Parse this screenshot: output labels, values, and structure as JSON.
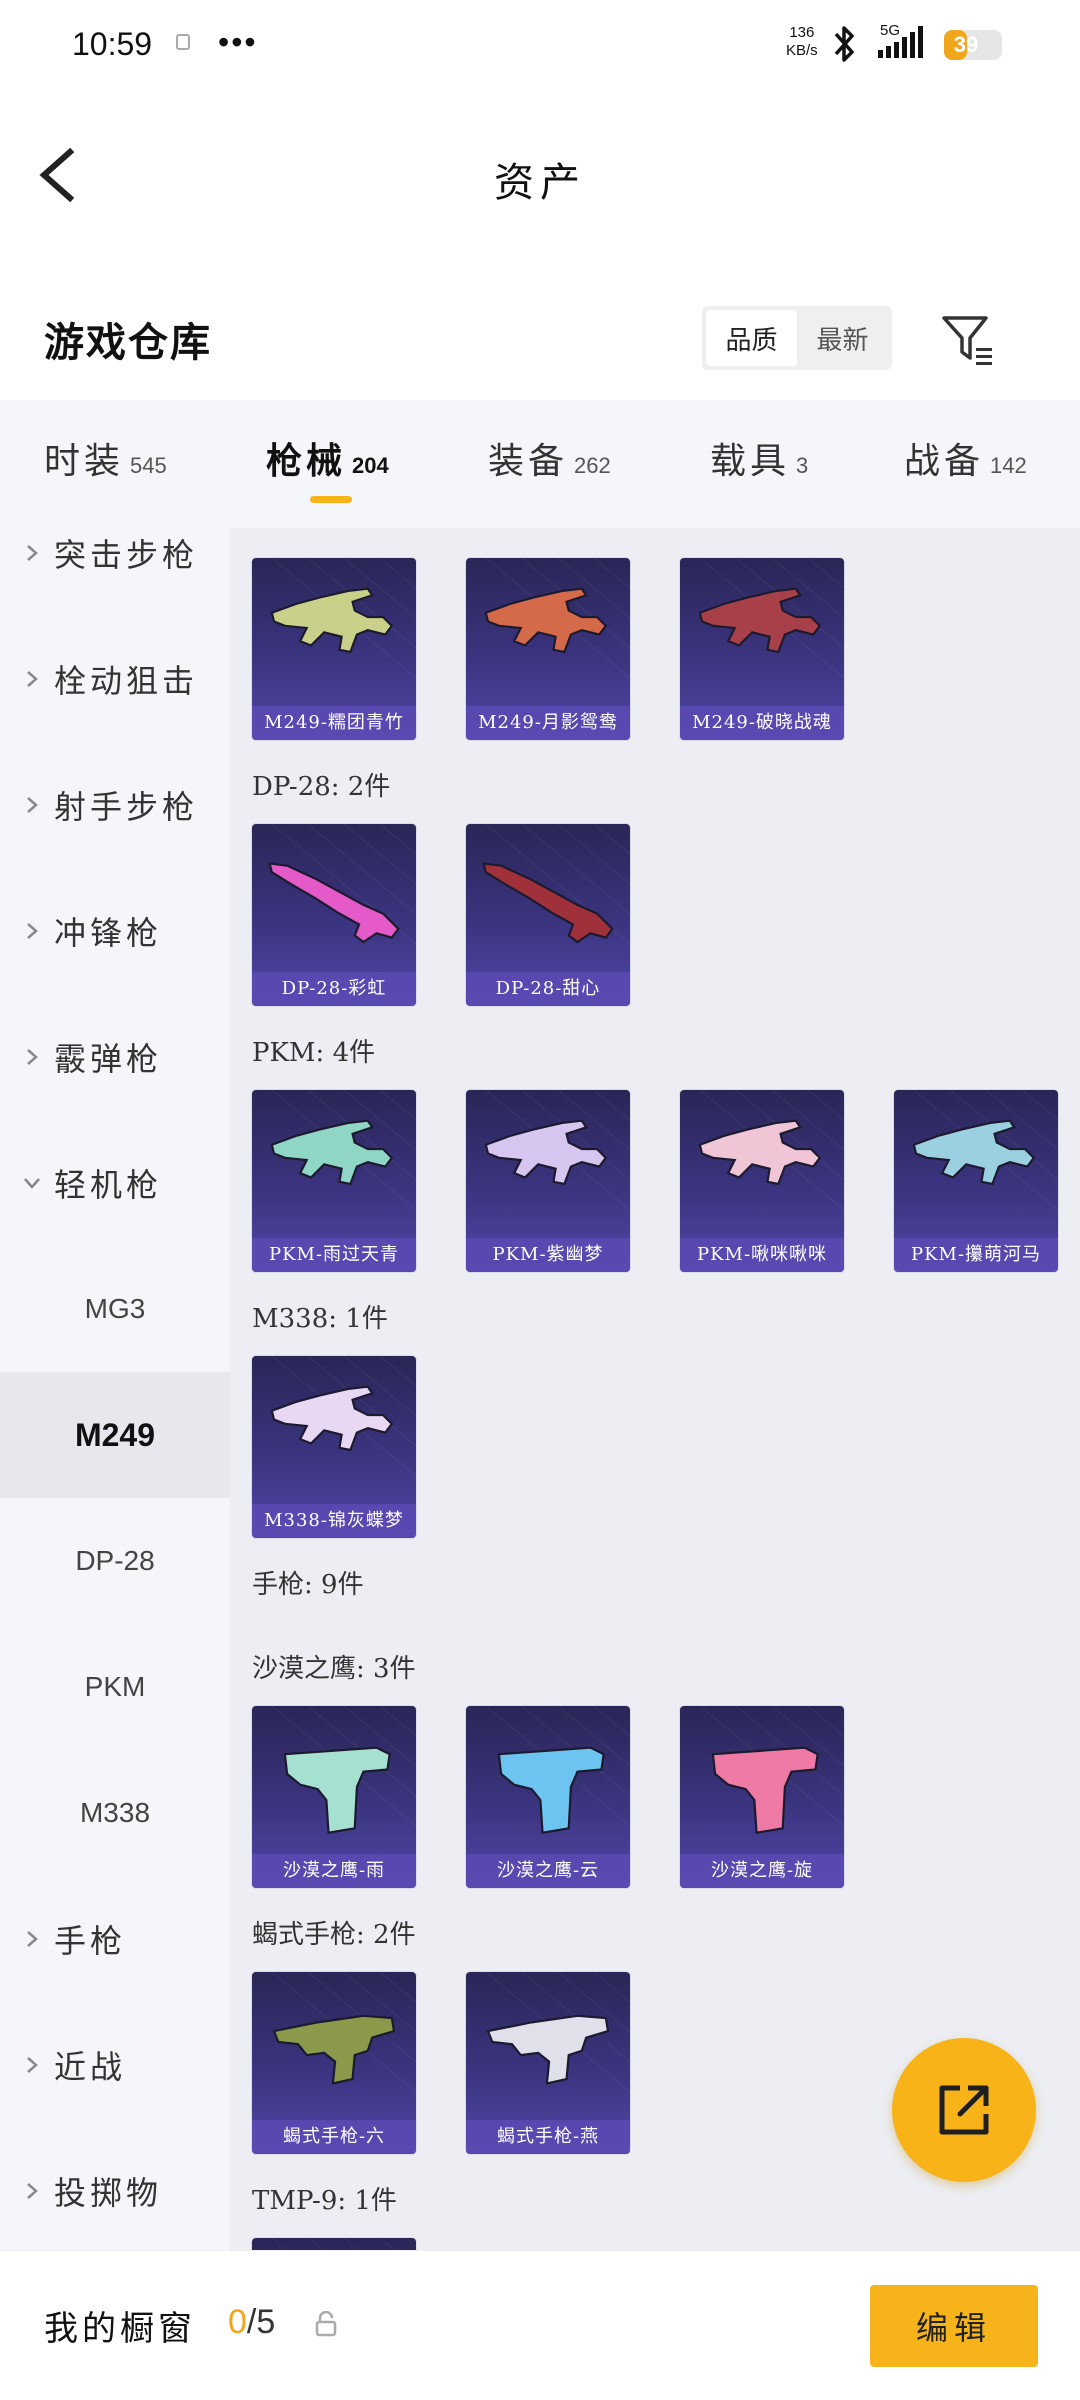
{
  "status_bar": {
    "time": "10:59",
    "more": "•••",
    "net_speed_value": "136",
    "net_speed_unit": "KB/s",
    "network": "5G",
    "battery": "39",
    "battery_level": 0.39
  },
  "header": {
    "title": "资产"
  },
  "warehouse": {
    "title": "游戏仓库",
    "sort_options": [
      "品质",
      "最新"
    ],
    "active_sort": "品质"
  },
  "tabs": [
    {
      "label": "时装",
      "count": "545"
    },
    {
      "label": "枪械",
      "count": "204",
      "active": true
    },
    {
      "label": "装备",
      "count": "262"
    },
    {
      "label": "载具",
      "count": "3"
    },
    {
      "label": "战备",
      "count": "142"
    }
  ],
  "sidebar": {
    "categories": [
      "突击步枪",
      "栓动狙击",
      "射手步枪",
      "冲锋枪",
      "霰弹枪",
      "轻机枪",
      "手枪",
      "近战",
      "投掷物"
    ],
    "subitems": [
      "MG3",
      "M249",
      "DP-28",
      "PKM",
      "M338"
    ],
    "active_subitem": "M249"
  },
  "content": {
    "groups": [
      {
        "label": "",
        "items": [
          "M249-糯团青竹",
          "M249-月影鸳鸯",
          "M249-破晓战魂"
        ]
      },
      {
        "label": "DP-28: 2件",
        "items": [
          "DP-28-彩虹",
          "DP-28-甜心"
        ]
      },
      {
        "label": "PKM: 4件",
        "items": [
          "PKM-雨过天青",
          "PKM-紫幽梦",
          "PKM-啾咪啾咪",
          "PKM-攥萌河马"
        ]
      },
      {
        "label": "M338: 1件",
        "items": [
          "M338-锦灰蝶梦"
        ]
      },
      {
        "label": "手枪: 9件",
        "items": []
      },
      {
        "label": "沙漠之鹰: 3件",
        "items": [
          "沙漠之鹰-雨",
          "沙漠之鹰-云",
          "沙漠之鹰-旋"
        ]
      },
      {
        "label": "蝎式手枪: 2件",
        "items": [
          "蝎式手枪-六",
          "蝎式手枪-燕"
        ]
      },
      {
        "label": "TMP-9: 1件",
        "items": []
      }
    ]
  },
  "bottom_bar": {
    "title": "我的橱窗",
    "count_current": "0",
    "count_total": "/5",
    "edit_label": "编辑"
  },
  "icons": {
    "back": "back-arrow-icon",
    "filter": "filter-icon",
    "chevron": "chevron-right-icon",
    "chevron_open": "chevron-down-icon",
    "lock": "lock-icon",
    "share": "share-external-icon"
  },
  "colors": {
    "accent": "#f6b41a",
    "card_top": "#2a2656",
    "card_bottom": "#5147a6"
  }
}
